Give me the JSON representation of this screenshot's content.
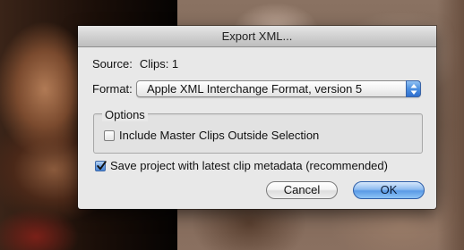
{
  "dialog": {
    "title": "Export XML...",
    "source_label": "Source:",
    "source_value": "Clips: 1",
    "format_label": "Format:",
    "format_value": "Apple XML Interchange Format, version 5",
    "options_title": "Options",
    "include_master_label": "Include Master Clips Outside Selection",
    "include_master_checked": false,
    "save_project_label": "Save project with latest clip metadata (recommended)",
    "save_project_checked": true,
    "cancel_label": "Cancel",
    "ok_label": "OK"
  },
  "colors": {
    "accent": "#4b8fe0",
    "dialog_bg": "#e8e8e8"
  },
  "icons": {
    "format_stepper": "up-down-arrows-icon",
    "checkmark": "checkmark-icon"
  }
}
